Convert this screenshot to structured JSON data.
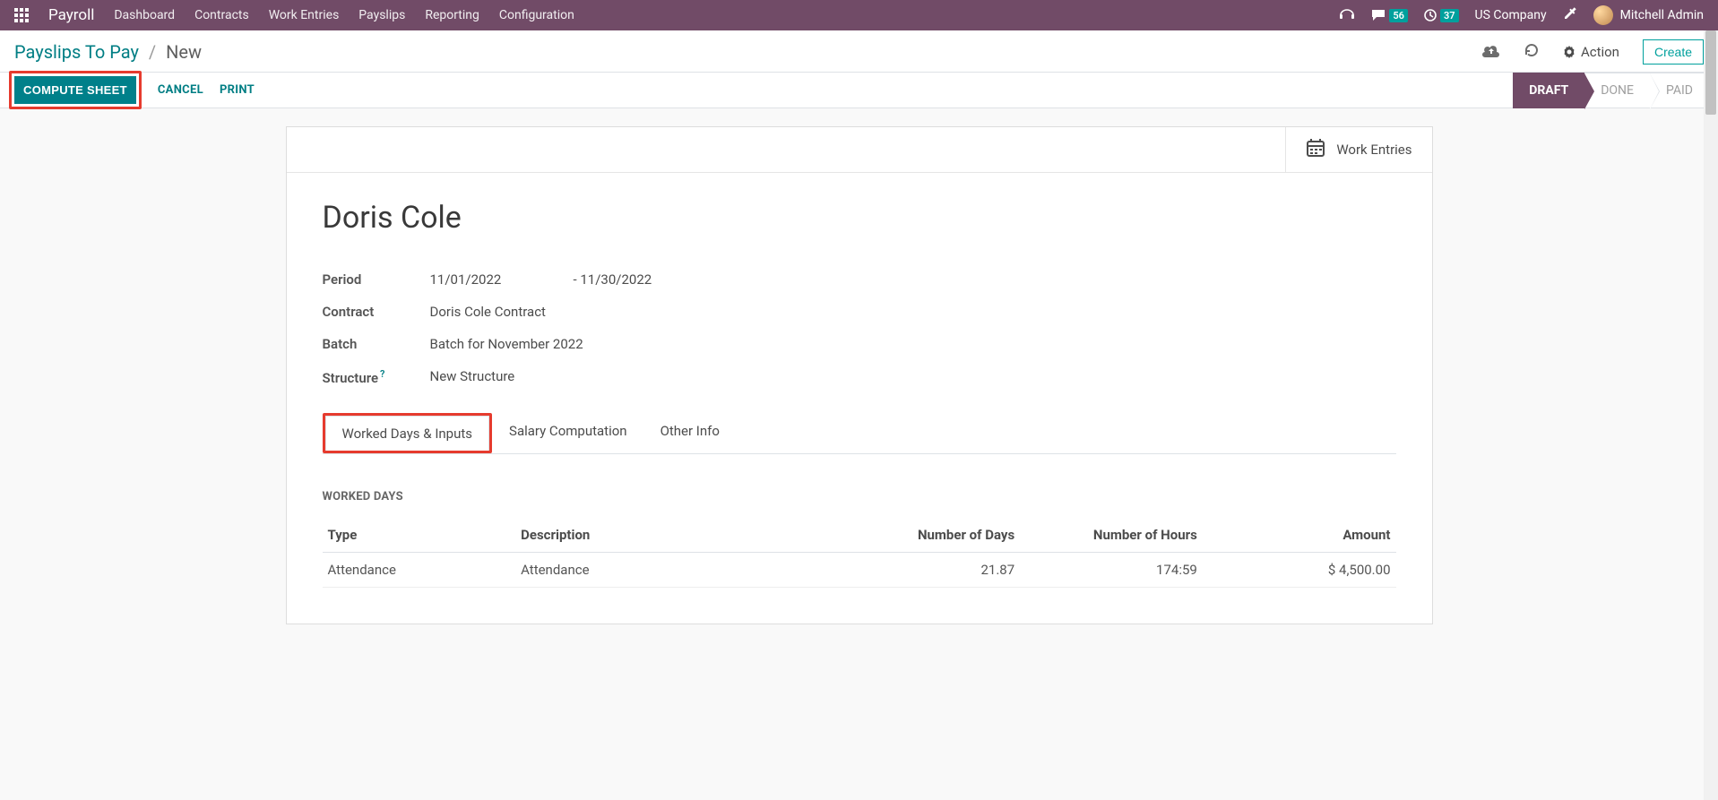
{
  "nav": {
    "app_name": "Payroll",
    "menu": [
      "Dashboard",
      "Contracts",
      "Work Entries",
      "Payslips",
      "Reporting",
      "Configuration"
    ],
    "messages_count": "56",
    "activity_count": "37",
    "company": "US Company",
    "user": "Mitchell Admin"
  },
  "breadcrumb": {
    "parent": "Payslips To Pay",
    "current": "New"
  },
  "cp": {
    "action_label": "Action",
    "create_label": "Create"
  },
  "buttons": {
    "compute": "COMPUTE SHEET",
    "cancel": "CANCEL",
    "print": "PRINT"
  },
  "status": {
    "steps": [
      "DRAFT",
      "DONE",
      "PAID"
    ],
    "active": "DRAFT"
  },
  "stat_button": {
    "label": "Work Entries"
  },
  "record": {
    "employee_name": "Doris Cole",
    "fields": {
      "period_label": "Period",
      "period_start": "11/01/2022",
      "period_end": "- 11/30/2022",
      "contract_label": "Contract",
      "contract_value": "Doris Cole Contract",
      "batch_label": "Batch",
      "batch_value": "Batch for November 2022",
      "structure_label": "Structure",
      "structure_value": "New Structure"
    }
  },
  "tabs": [
    "Worked Days & Inputs",
    "Salary Computation",
    "Other Info"
  ],
  "worked_days": {
    "section_title": "WORKED DAYS",
    "columns": [
      "Type",
      "Description",
      "Number of Days",
      "Number of Hours",
      "Amount"
    ],
    "rows": [
      {
        "type": "Attendance",
        "description": "Attendance",
        "days": "21.87",
        "hours": "174:59",
        "amount": "$ 4,500.00"
      }
    ]
  }
}
